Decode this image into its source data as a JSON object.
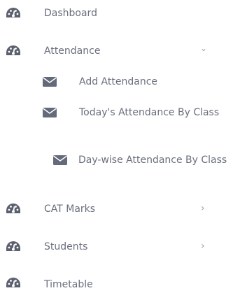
{
  "sidebar": {
    "items": [
      {
        "label": "Dashboard",
        "icon": "dashboard-gauge-icon"
      },
      {
        "label": "Attendance",
        "icon": "dashboard-gauge-icon",
        "chevron": "⌄",
        "expanded": true,
        "children": [
          {
            "label": "Add Attendance",
            "icon": "envelope-icon"
          },
          {
            "label": "Today's Attendance By Class",
            "icon": "envelope-icon"
          },
          {
            "label": "Day-wise Attendance By Class",
            "icon": "envelope-icon"
          }
        ]
      },
      {
        "label": "CAT Marks",
        "icon": "dashboard-gauge-icon",
        "chevron": "›"
      },
      {
        "label": "Students",
        "icon": "dashboard-gauge-icon",
        "chevron": "›"
      },
      {
        "label": "Timetable",
        "icon": "dashboard-gauge-icon"
      }
    ]
  },
  "colors": {
    "text": "#6b6f7e",
    "icon": "#5b5f6e",
    "envelope": "#656a7a",
    "chevron": "#9a9eab"
  }
}
